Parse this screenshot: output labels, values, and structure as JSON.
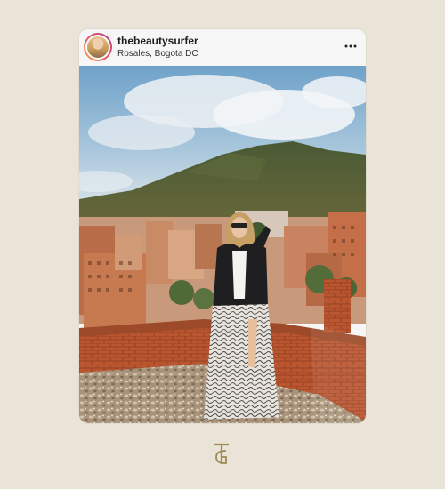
{
  "post": {
    "username": "thebeautysurfer",
    "location": "Rosales, Bogota DC",
    "image_description_icon": "photo",
    "more_icon": "more-horizontal-icon"
  },
  "brand": {
    "logo_icon": "monogram-logo",
    "logo_color": "#a08a52"
  },
  "colors": {
    "background": "#e9e4d7",
    "card": "#f6f6f7",
    "avatar_ring_start": "#f6b04c",
    "avatar_ring_end": "#b2378f"
  }
}
